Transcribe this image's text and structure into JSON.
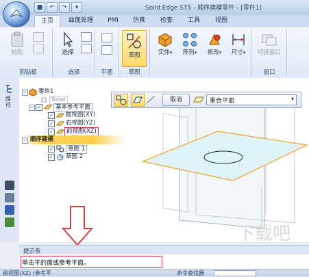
{
  "window": {
    "title": "Solid Edge ST5 - 顺序建模零件 - [零件1]"
  },
  "tabs": [
    {
      "label": "主页",
      "active": true
    },
    {
      "label": "曲面处理",
      "active": false
    },
    {
      "label": "PMI",
      "active": false
    },
    {
      "label": "仿真",
      "active": false
    },
    {
      "label": "检查",
      "active": false
    },
    {
      "label": "工具",
      "active": false
    },
    {
      "label": "视图",
      "active": false
    }
  ],
  "ribbon": {
    "clipboard": {
      "paste": "粘贴",
      "group": "剪贴板"
    },
    "select": {
      "select": "选择",
      "group": "选择"
    },
    "plane": {
      "group": "平面"
    },
    "sketch": {
      "sketch": "草图",
      "group": "草图"
    },
    "solid": {
      "label": "实体"
    },
    "pattern": {
      "label": "阵列"
    },
    "modify": {
      "label": "修改"
    },
    "dimension": {
      "label": "尺寸"
    },
    "window": {
      "switch": "切换窗口",
      "group": "窗口"
    }
  },
  "rail": {
    "tab_label": "路径"
  },
  "path_finder": {
    "part": "零件1",
    "base": "Base",
    "ref_planes": "基本参考平面",
    "front": "前视图(XY)",
    "right": "右视图(YZ)",
    "top": "前视图(XZ)",
    "ordered": "顺序建模",
    "sketch1": "草图 1",
    "sketch2": "草图 2"
  },
  "command_bar": {
    "cancel": "取消",
    "plane_option": "重合平面"
  },
  "prompt": {
    "title": "提示条",
    "text": "单击平的面或参考平面。"
  },
  "status": {
    "left": "前视图(XZ) (参考平",
    "command_finder": "命令查找器"
  },
  "watermark": "下载吧",
  "colors": {
    "accent": "#f3a000",
    "annotation_red": "#d04040",
    "plane_orange": "#f0a030"
  }
}
